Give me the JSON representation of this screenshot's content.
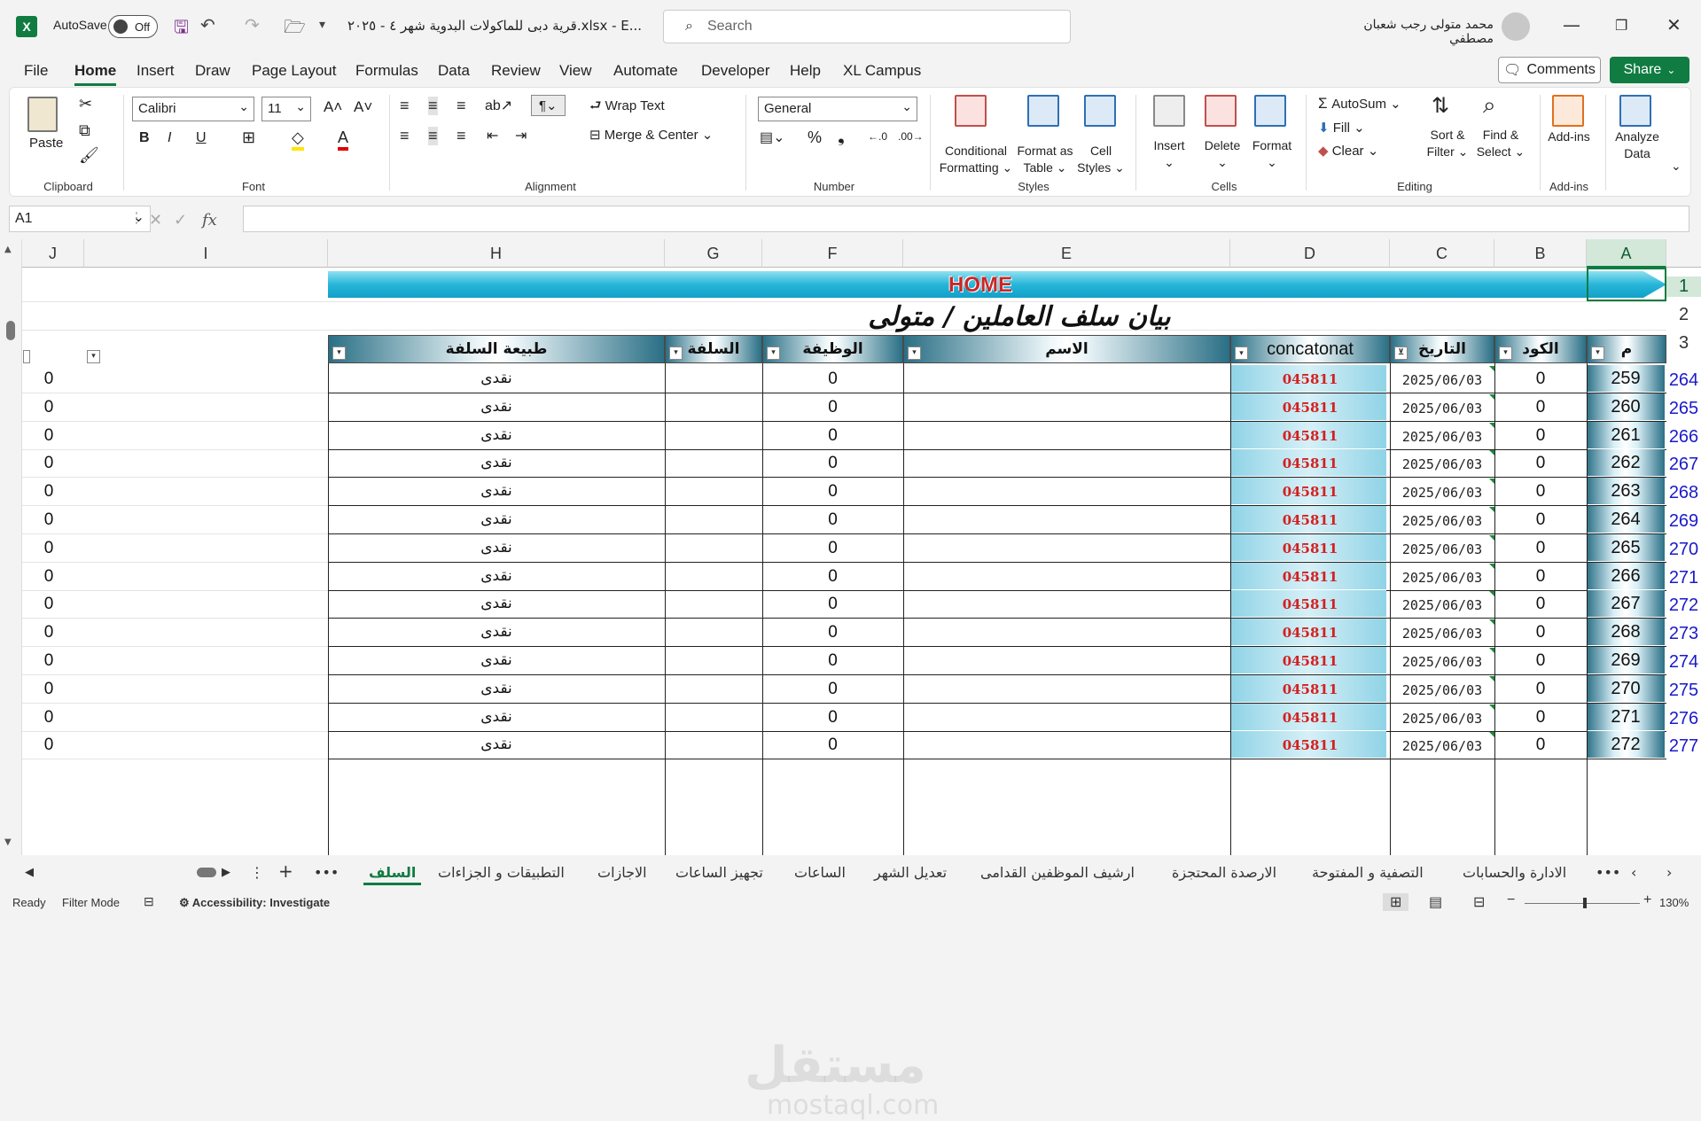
{
  "titlebar": {
    "app_icon_letter": "X",
    "autosave_label": "AutoSave",
    "autosave_state": "Off",
    "filename": "قرية دبى للماكولات البدوية شهر ٤ - ٢٠٢٥.xlsx  -  E...",
    "search_placeholder": "Search",
    "user_name": "محمد متولى رجب شعبان مصطفي"
  },
  "menu": {
    "tabs": [
      "File",
      "Home",
      "Insert",
      "Draw",
      "Page Layout",
      "Formulas",
      "Data",
      "Review",
      "View",
      "Automate",
      "Developer",
      "Help",
      "XL Campus"
    ],
    "active_tab": "Home",
    "comments_label": "Comments",
    "share_label": "Share"
  },
  "ribbon": {
    "clipboard": {
      "paste": "Paste",
      "label": "Clipboard"
    },
    "font": {
      "name": "Calibri",
      "size": "11",
      "label": "Font"
    },
    "alignment": {
      "wrap_text": "Wrap Text",
      "merge_center": "Merge & Center",
      "label": "Alignment"
    },
    "number": {
      "format": "General",
      "label": "Number"
    },
    "styles": {
      "conditional": "Conditional",
      "conditional2": "Formatting",
      "format_as": "Format as",
      "format_as2": "Table",
      "cell_styles": "Cell",
      "cell_styles2": "Styles",
      "label": "Styles"
    },
    "cells": {
      "insert": "Insert",
      "delete": "Delete",
      "format": "Format",
      "label": "Cells"
    },
    "editing": {
      "autosum": "AutoSum",
      "fill": "Fill",
      "clear": "Clear",
      "sort": "Sort &",
      "sort2": "Filter",
      "find": "Find &",
      "find2": "Select",
      "label": "Editing"
    },
    "addins": {
      "addins": "Add-ins",
      "label": "Add-ins"
    },
    "analyze": {
      "line1": "Analyze",
      "line2": "Data"
    }
  },
  "formula_bar": {
    "name_box": "A1",
    "fx": "fx",
    "content": ""
  },
  "columns": [
    "J",
    "I",
    "H",
    "G",
    "F",
    "E",
    "D",
    "C",
    "B",
    "A"
  ],
  "selected_column": "A",
  "sheet": {
    "banner": "HOME",
    "title": "بيان سلف العاملين / متولى",
    "headers": {
      "m": "م",
      "code": "الكود",
      "date": "التاريخ",
      "concat": "concatonat",
      "name": "الاسم",
      "job": "الوظيفة",
      "advance": "السلفة",
      "type": "طبيعة السلفة"
    },
    "header_row_numbers": [
      "1",
      "2",
      "3"
    ],
    "rows": [
      {
        "row": "264",
        "m": "259",
        "code": "0",
        "date": "2025/06/03",
        "concat": "045811",
        "job": "0",
        "type": "نقدى",
        "j": "0"
      },
      {
        "row": "265",
        "m": "260",
        "code": "0",
        "date": "2025/06/03",
        "concat": "045811",
        "job": "0",
        "type": "نقدى",
        "j": "0"
      },
      {
        "row": "266",
        "m": "261",
        "code": "0",
        "date": "2025/06/03",
        "concat": "045811",
        "job": "0",
        "type": "نقدى",
        "j": "0"
      },
      {
        "row": "267",
        "m": "262",
        "code": "0",
        "date": "2025/06/03",
        "concat": "045811",
        "job": "0",
        "type": "نقدى",
        "j": "0"
      },
      {
        "row": "268",
        "m": "263",
        "code": "0",
        "date": "2025/06/03",
        "concat": "045811",
        "job": "0",
        "type": "نقدى",
        "j": "0"
      },
      {
        "row": "269",
        "m": "264",
        "code": "0",
        "date": "2025/06/03",
        "concat": "045811",
        "job": "0",
        "type": "نقدى",
        "j": "0"
      },
      {
        "row": "270",
        "m": "265",
        "code": "0",
        "date": "2025/06/03",
        "concat": "045811",
        "job": "0",
        "type": "نقدى",
        "j": "0"
      },
      {
        "row": "271",
        "m": "266",
        "code": "0",
        "date": "2025/06/03",
        "concat": "045811",
        "job": "0",
        "type": "نقدى",
        "j": "0"
      },
      {
        "row": "272",
        "m": "267",
        "code": "0",
        "date": "2025/06/03",
        "concat": "045811",
        "job": "0",
        "type": "نقدى",
        "j": "0"
      },
      {
        "row": "273",
        "m": "268",
        "code": "0",
        "date": "2025/06/03",
        "concat": "045811",
        "job": "0",
        "type": "نقدى",
        "j": "0"
      },
      {
        "row": "274",
        "m": "269",
        "code": "0",
        "date": "2025/06/03",
        "concat": "045811",
        "job": "0",
        "type": "نقدى",
        "j": "0"
      },
      {
        "row": "275",
        "m": "270",
        "code": "0",
        "date": "2025/06/03",
        "concat": "045811",
        "job": "0",
        "type": "نقدى",
        "j": "0"
      },
      {
        "row": "276",
        "m": "271",
        "code": "0",
        "date": "2025/06/03",
        "concat": "045811",
        "job": "0",
        "type": "نقدى",
        "j": "0"
      },
      {
        "row": "277",
        "m": "272",
        "code": "0",
        "date": "2025/06/03",
        "concat": "045811",
        "job": "0",
        "type": "نقدى",
        "j": "0"
      }
    ]
  },
  "sheet_tabs": [
    "السلف",
    "التطبيقات و الجزاءات",
    "الاجازات",
    "تجهيز الساعات",
    "الساعات",
    "تعديل الشهر",
    "ارشيف الموظفين القدامى",
    "الارصدة المحتجزة",
    "التصفية و المفتوحة",
    "الادارة والحسابات"
  ],
  "active_sheet": "السلف",
  "status": {
    "ready": "Ready",
    "filter_mode": "Filter Mode",
    "accessibility": "Accessibility: Investigate",
    "zoom": "130%"
  },
  "watermark": {
    "line1": "مستقل",
    "line2": "mostaql.com"
  },
  "colors": {
    "excel_green": "#107c41",
    "code_red": "#d32020",
    "row_blue": "#1a1acc",
    "banner_cyan": "#27b6d9"
  }
}
